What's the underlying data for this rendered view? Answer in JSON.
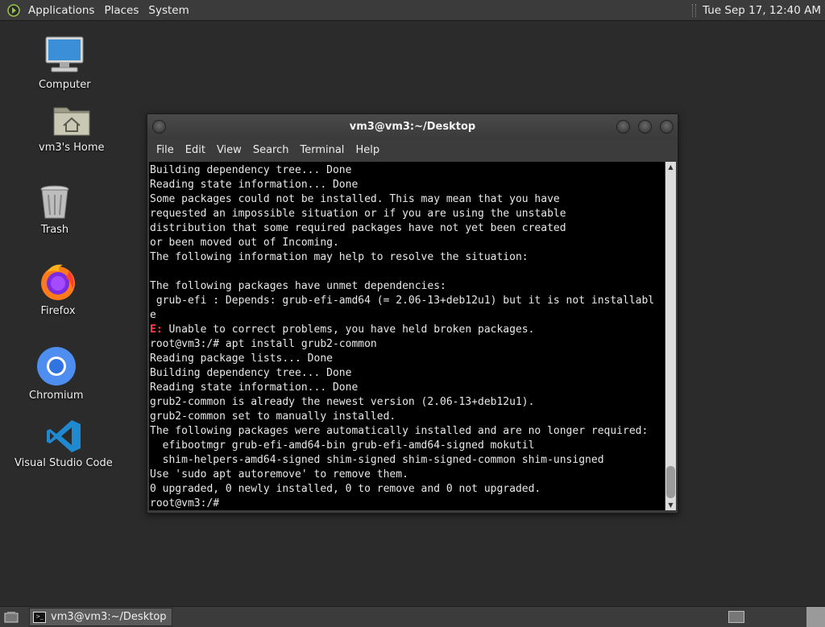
{
  "top_panel": {
    "menus": [
      "Applications",
      "Places",
      "System"
    ],
    "clock": "Tue Sep 17, 12:40 AM"
  },
  "desktop": {
    "icons": [
      {
        "label": "Computer",
        "icon": "computer-icon"
      },
      {
        "label": "vm3's Home",
        "icon": "home-folder-icon"
      },
      {
        "label": "Trash",
        "icon": "trash-icon"
      },
      {
        "label": "Firefox",
        "icon": "firefox-icon"
      },
      {
        "label": "Chromium",
        "icon": "chromium-icon"
      },
      {
        "label": "Visual Studio Code",
        "icon": "vscode-icon"
      }
    ]
  },
  "terminal": {
    "title": "vm3@vm3:~/Desktop",
    "menu": [
      "File",
      "Edit",
      "View",
      "Search",
      "Terminal",
      "Help"
    ],
    "lines": [
      "Building dependency tree... Done",
      "Reading state information... Done",
      "Some packages could not be installed. This may mean that you have",
      "requested an impossible situation or if you are using the unstable",
      "distribution that some required packages have not yet been created",
      "or been moved out of Incoming.",
      "The following information may help to resolve the situation:",
      "",
      "The following packages have unmet dependencies:",
      " grub-efi : Depends: grub-efi-amd64 (= 2.06-13+deb12u1) but it is not installabl",
      "e",
      "E: Unable to correct problems, you have held broken packages.",
      "root@vm3:/# apt install grub2-common",
      "Reading package lists... Done",
      "Building dependency tree... Done",
      "Reading state information... Done",
      "grub2-common is already the newest version (2.06-13+deb12u1).",
      "grub2-common set to manually installed.",
      "The following packages were automatically installed and are no longer required:",
      "  efibootmgr grub-efi-amd64-bin grub-efi-amd64-signed mokutil",
      "  shim-helpers-amd64-signed shim-signed shim-signed-common shim-unsigned",
      "Use 'sudo apt autoremove' to remove them.",
      "0 upgraded, 0 newly installed, 0 to remove and 0 not upgraded.",
      "root@vm3:/# "
    ],
    "error_prefix": "E:",
    "error_color": "#ff3b3b"
  },
  "taskbar": {
    "task_label": "vm3@vm3:~/Desktop"
  }
}
